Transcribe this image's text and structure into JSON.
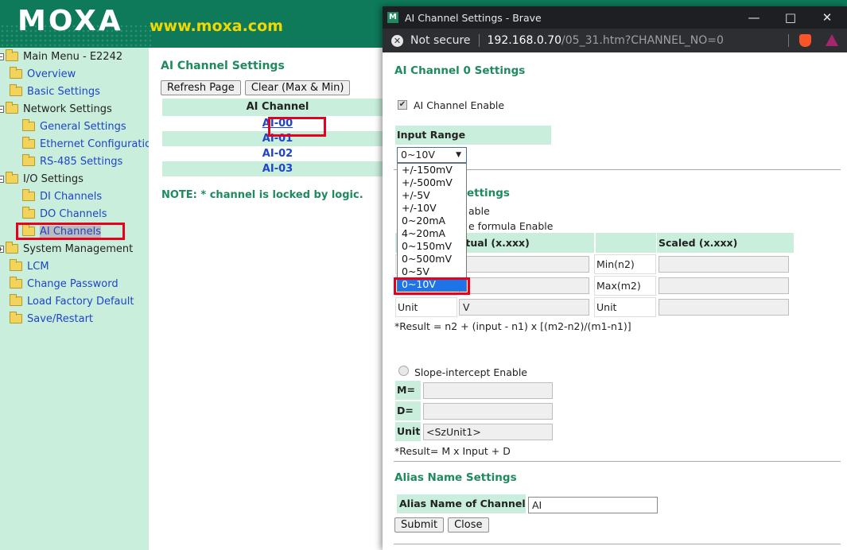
{
  "banner": {
    "logo": "MOXA",
    "url": "www.moxa.com"
  },
  "tree": [
    {
      "label": "Main Menu - E2242",
      "kind": "root"
    },
    {
      "label": "Overview",
      "kind": "leaf"
    },
    {
      "label": "Basic Settings",
      "kind": "leaf"
    },
    {
      "label": "Network Settings",
      "kind": "group"
    },
    {
      "label": "General Settings",
      "kind": "sub"
    },
    {
      "label": "Ethernet Configuration",
      "kind": "sub"
    },
    {
      "label": "RS-485 Settings",
      "kind": "sub"
    },
    {
      "label": "I/O Settings",
      "kind": "group"
    },
    {
      "label": "DI Channels",
      "kind": "sub"
    },
    {
      "label": "DO Channels",
      "kind": "sub"
    },
    {
      "label": "AI Channels",
      "kind": "sub",
      "selected": true
    },
    {
      "label": "System Management",
      "kind": "group"
    },
    {
      "label": "LCM",
      "kind": "leaf"
    },
    {
      "label": "Change Password",
      "kind": "leaf"
    },
    {
      "label": "Load Factory Default",
      "kind": "leaf"
    },
    {
      "label": "Save/Restart",
      "kind": "leaf"
    }
  ],
  "main": {
    "title": "AI Channel Settings",
    "refresh_label": "Refresh Page",
    "clear_label": "Clear (Max & Min)",
    "table_header": "AI Channel",
    "channels": [
      "AI-00",
      "AI-01",
      "AI-02",
      "AI-03"
    ],
    "note": "NOTE: * channel is locked by logic."
  },
  "browser": {
    "window_title": "AI Channel Settings - Brave",
    "not_secure": "Not secure",
    "url_host": "192.168.0.70",
    "url_path": "/05_31.htm?CHANNEL_NO=0",
    "favicon": "M"
  },
  "popup": {
    "channel_title": "AI Channel 0  Settings",
    "enable_label": "AI Channel Enable",
    "enable_checked": true,
    "input_range_label": "Input Range",
    "selected_range": "0~10V",
    "range_options": [
      "+/-150mV",
      "+/-500mV",
      "+/-5V",
      "+/-10V",
      "0~20mA",
      "4~20mA",
      "0~150mV",
      "0~500mV",
      "0~5V",
      "0~10V"
    ],
    "scaling_title_partial": "g Settings",
    "scaling_enable_partial": "able",
    "formula_partial": "e formula Enable",
    "actual_header_partial": "ctual (x.xxx)",
    "scaled_header": "Scaled (x.xxx)",
    "min_label": "Min(n2)",
    "max_label": "Max(m2)",
    "unit_label": "Unit",
    "unit_actual": "V",
    "unit_scaled_label": "Unit",
    "result_formula": "*Result = n2 + (input - n1) x [(m2-n2)/(m1-n1)]",
    "slope_label": "Slope-intercept Enable",
    "m_label": "M=",
    "d_label": "D=",
    "slope_unit_label": "Unit",
    "slope_unit_value": "<SzUnit1>",
    "slope_result": "*Result= M x Input + D",
    "alias_title": "Alias Name Settings",
    "alias_label": "Alias Name of Channel",
    "alias_value": "AI",
    "submit_label": "Submit",
    "close_label": "Close"
  }
}
